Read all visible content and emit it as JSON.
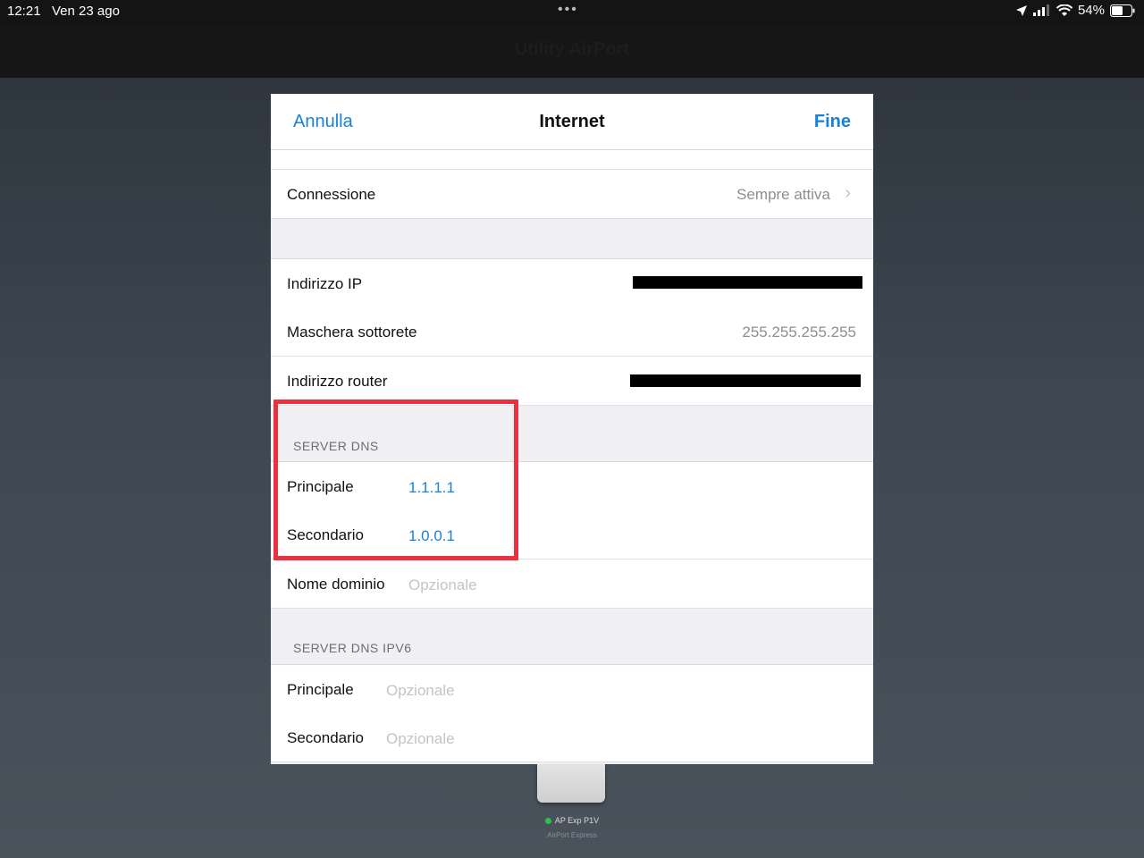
{
  "status_bar": {
    "time": "12:21",
    "date": "Ven 23 ago",
    "battery": "54%"
  },
  "app": {
    "title": "Utility AirPort"
  },
  "modal": {
    "cancel_label": "Annulla",
    "title": "Internet",
    "done_label": "Fine",
    "rows": {
      "connection": {
        "label": "Connessione",
        "value": "Sempre attiva"
      },
      "ip_address": {
        "label": "Indirizzo IP"
      },
      "subnet_mask": {
        "label": "Maschera sottorete",
        "value": "255.255.255.255"
      },
      "router_address": {
        "label": "Indirizzo router"
      }
    },
    "dns": {
      "header": "SERVER DNS",
      "primary_label": "Principale",
      "primary_value": "1.1.1.1",
      "secondary_label": "Secondario",
      "secondary_value": "1.0.0.1",
      "domain_label": "Nome dominio",
      "domain_placeholder": "Opzionale"
    },
    "dns_ipv6": {
      "header": "SERVER DNS IPV6",
      "primary_label": "Principale",
      "primary_placeholder": "Opzionale",
      "secondary_label": "Secondario",
      "secondary_placeholder": "Opzionale"
    }
  },
  "device": {
    "name": "AP Exp P1V",
    "model": "AirPort Express",
    "status_color": "#31c14a"
  },
  "colors": {
    "accent": "#1a82d6",
    "highlight": "#e8323f"
  }
}
